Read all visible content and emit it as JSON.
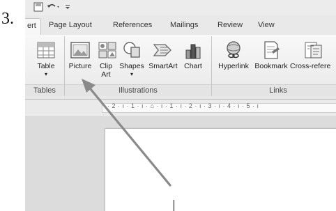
{
  "step_number": "3.",
  "tabs": [
    {
      "label": "ert",
      "active": true
    },
    {
      "label": "Page Layout"
    },
    {
      "label": "References"
    },
    {
      "label": "Mailings"
    },
    {
      "label": "Review"
    },
    {
      "label": "View"
    }
  ],
  "ribbon": {
    "tables": {
      "label": "Tables",
      "commands": {
        "table": "Table"
      }
    },
    "illustrations": {
      "label": "Illustrations",
      "commands": {
        "picture": "Picture",
        "clip_art": "Clip Art",
        "shapes": "Shapes",
        "smartart": "SmartArt",
        "chart": "Chart"
      }
    },
    "links": {
      "label": "Links",
      "commands": {
        "hyperlink": "Hyperlink",
        "bookmark": "Bookmark",
        "cross_reference": "Cross-refere"
      }
    }
  },
  "ruler": {
    "text": "· 2 · ı · 1 · ı · ⌂ · ı · 1 · ı · 2 · ı · 3 · ı · 4 · ı · 5 · ı"
  },
  "colors": {
    "arrow": "#8a8a8a"
  }
}
